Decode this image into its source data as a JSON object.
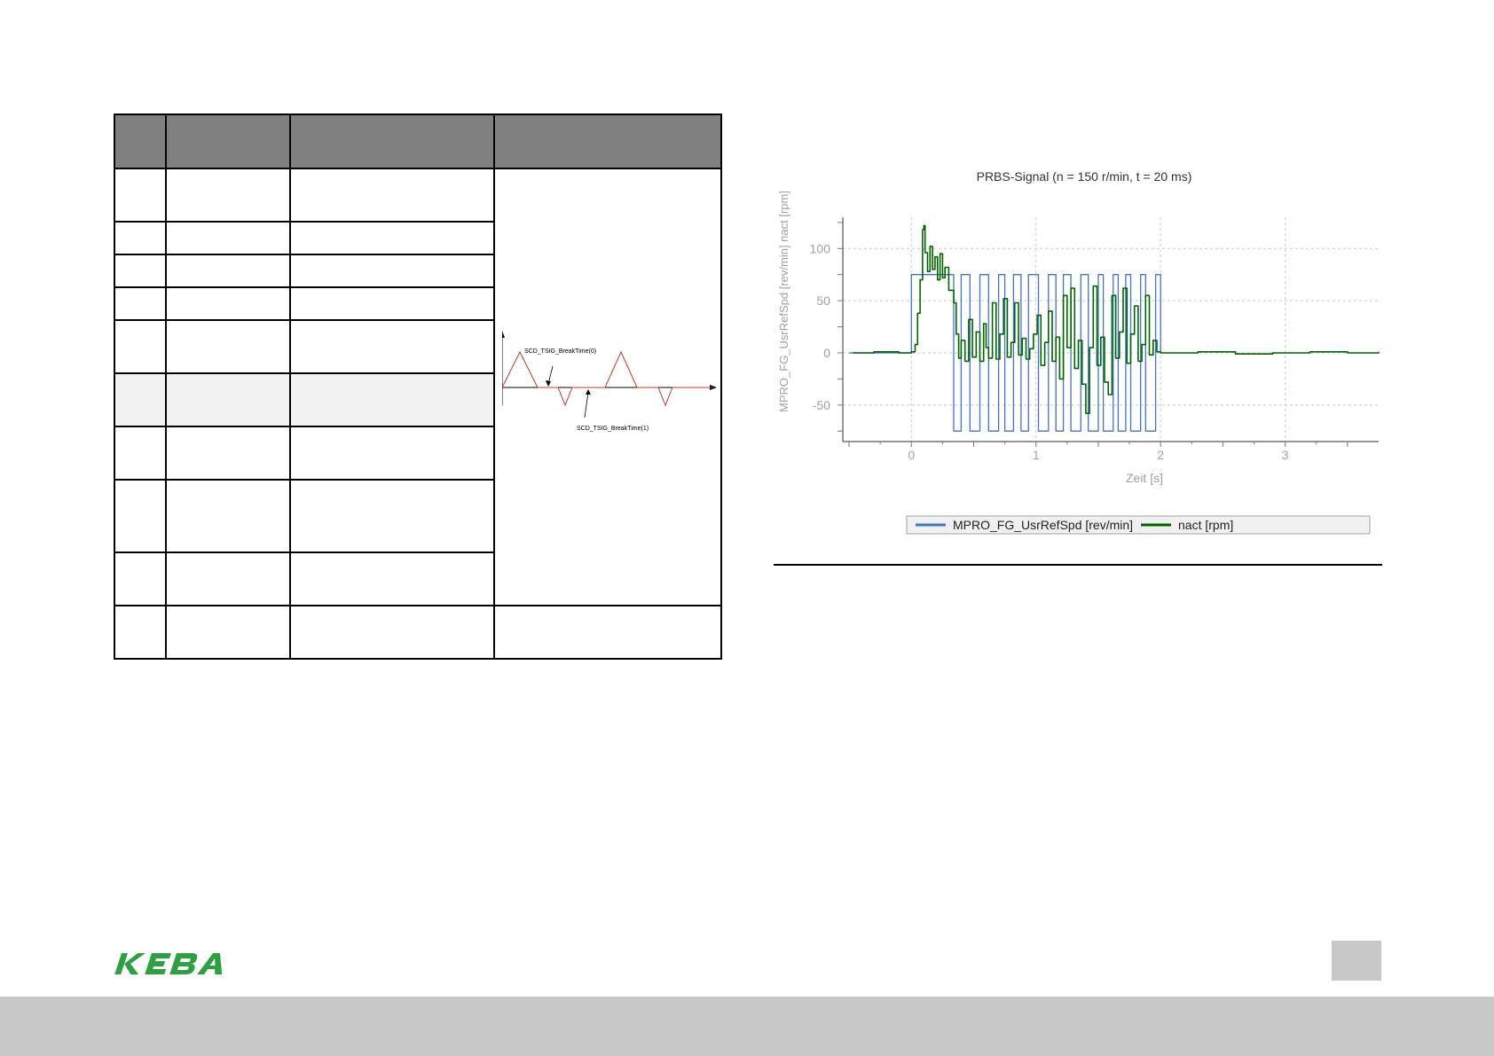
{
  "diagram": {
    "label_break_time_0": "SCD_TSIG_BreakTime(0)",
    "label_break_time_1": "SCD_TSIG_BreakTime(1)",
    "waveform_color": "#c0392b"
  },
  "chart_data": {
    "type": "line",
    "title": "PRBS-Signal (n = 150 r/min, t = 20 ms)",
    "xlabel": "Zeit [s]",
    "ylabel": "MPRO_FG_UsrRefSpd [rev/min]  nact [rpm]",
    "xlim": [
      -0.55,
      3.75
    ],
    "ylim": [
      -85,
      130
    ],
    "x_ticks": [
      "0",
      "1",
      "2",
      "3"
    ],
    "y_ticks": [
      "100",
      "50",
      "0",
      "-50"
    ],
    "grid": true,
    "legend_position": "bottom",
    "series": [
      {
        "name": "MPRO_FG_UsrRefSpd [rev/min]",
        "color": "#4472c4",
        "x": [
          -0.5,
          0.0,
          0.0,
          0.34,
          0.34,
          0.4,
          0.4,
          0.47,
          0.47,
          0.55,
          0.55,
          0.62,
          0.62,
          0.7,
          0.7,
          0.75,
          0.75,
          0.82,
          0.82,
          0.88,
          0.88,
          0.94,
          0.94,
          1.02,
          1.02,
          1.1,
          1.1,
          1.16,
          1.16,
          1.22,
          1.22,
          1.28,
          1.28,
          1.36,
          1.36,
          1.42,
          1.42,
          1.5,
          1.5,
          1.54,
          1.54,
          1.62,
          1.62,
          1.66,
          1.66,
          1.72,
          1.72,
          1.76,
          1.76,
          1.84,
          1.84,
          1.88,
          1.88,
          1.96,
          1.96,
          2.0,
          2.0
        ],
        "y": [
          0,
          0,
          75,
          75,
          -75,
          -75,
          75,
          75,
          -75,
          -75,
          75,
          75,
          -75,
          -75,
          75,
          75,
          -75,
          -75,
          75,
          75,
          -75,
          -75,
          75,
          75,
          -75,
          -75,
          75,
          75,
          -75,
          -75,
          75,
          75,
          -75,
          -75,
          75,
          75,
          -75,
          -75,
          75,
          75,
          -75,
          -75,
          75,
          75,
          -75,
          -75,
          75,
          75,
          -75,
          -75,
          75,
          75,
          -75,
          -75,
          75,
          75,
          0
        ]
      },
      {
        "name": "nact [rpm]",
        "color": "#006400",
        "x": [
          -0.47,
          -0.3,
          -0.1,
          0.0,
          0.03,
          0.05,
          0.07,
          0.09,
          0.1,
          0.11,
          0.13,
          0.15,
          0.17,
          0.19,
          0.21,
          0.23,
          0.25,
          0.27,
          0.3,
          0.34,
          0.36,
          0.38,
          0.4,
          0.43,
          0.46,
          0.49,
          0.52,
          0.55,
          0.58,
          0.6,
          0.62,
          0.65,
          0.68,
          0.71,
          0.74,
          0.77,
          0.8,
          0.83,
          0.86,
          0.89,
          0.92,
          0.95,
          0.98,
          1.01,
          1.04,
          1.07,
          1.1,
          1.13,
          1.16,
          1.19,
          1.22,
          1.25,
          1.28,
          1.31,
          1.34,
          1.37,
          1.4,
          1.43,
          1.46,
          1.49,
          1.52,
          1.55,
          1.58,
          1.61,
          1.64,
          1.67,
          1.7,
          1.73,
          1.76,
          1.79,
          1.82,
          1.85,
          1.88,
          1.91,
          1.94,
          1.97,
          2.0,
          2.3,
          2.6,
          2.9,
          3.2,
          3.5,
          3.75
        ],
        "y": [
          0,
          1,
          0,
          1,
          8,
          38,
          70,
          118,
          122,
          96,
          78,
          102,
          80,
          92,
          70,
          95,
          72,
          82,
          60,
          48,
          18,
          -5,
          12,
          -8,
          32,
          -4,
          20,
          -8,
          28,
          5,
          -5,
          48,
          -6,
          18,
          52,
          -4,
          10,
          48,
          -2,
          14,
          -6,
          4,
          18,
          36,
          -12,
          10,
          40,
          -8,
          15,
          -25,
          55,
          5,
          62,
          -15,
          12,
          -30,
          -58,
          5,
          64,
          -12,
          15,
          -28,
          -40,
          55,
          -5,
          20,
          62,
          -10,
          18,
          45,
          -8,
          8,
          55,
          -2,
          12,
          1,
          0,
          1,
          -1,
          0,
          1,
          0,
          1
        ]
      }
    ]
  }
}
